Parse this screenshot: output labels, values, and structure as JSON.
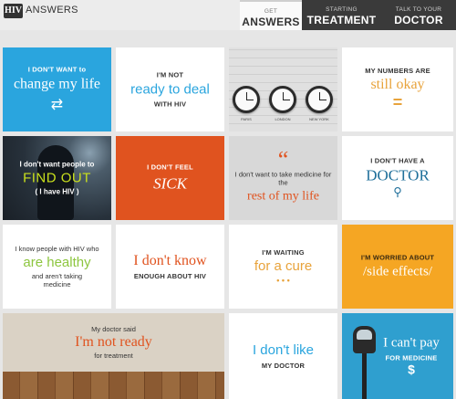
{
  "header": {
    "logo_box": "HIV",
    "logo_text": "ANSWERS",
    "nav": [
      {
        "small": "GET",
        "big": "ANSWERS"
      },
      {
        "small": "STARTING",
        "big": "TREATMENT"
      },
      {
        "small": "TALK TO YOUR",
        "big": "DOCTOR"
      }
    ]
  },
  "tiles": {
    "t1": {
      "top": "I DON'T WANT to",
      "main": "change my life",
      "icon": "⇄"
    },
    "t2": {
      "top": "I'M NOT",
      "main": "ready to deal",
      "bottom": "WITH HIV"
    },
    "t3": {
      "clocks": [
        "PARIS",
        "LONDON",
        "NEW YORK"
      ]
    },
    "t4": {
      "top": "MY NUMBERS ARE",
      "main": "still okay",
      "icon": "="
    },
    "t5": {
      "top": "I don't want people to",
      "main": "FIND OUT",
      "bottom": "( I have HIV )"
    },
    "t6": {
      "top": "I DON'T FEEL",
      "main": "SICK"
    },
    "t7": {
      "quote": "“",
      "top": "I don't want to take medicine for the",
      "main": "rest of my life"
    },
    "t8": {
      "top": "I DON'T HAVE A",
      "main": "DOCTOR",
      "icon": "⚲"
    },
    "t9": {
      "top": "I know people with HIV who",
      "main": "are healthy",
      "bottom": "and aren't taking medicine"
    },
    "t10": {
      "main": "I don't know",
      "bottom": "ENOUGH ABOUT HIV"
    },
    "t11": {
      "top": "I'M WAITING",
      "main": "for a cure",
      "icon": "• • •"
    },
    "t12": {
      "top": "I'M WORRIED ABOUT",
      "main": "/side effects/"
    },
    "t13": {
      "top": "My doctor said",
      "main": "I'm not ready",
      "bottom": "for treatment"
    },
    "t14": {
      "main": "I don't like",
      "bottom": "MY DOCTOR"
    },
    "t15": {
      "main": "I can't pay",
      "bottom": "FOR MEDICINE",
      "icon": "$"
    }
  },
  "colors": {
    "blue": "#2aa5de",
    "orange_red": "#e0531f",
    "amber": "#f5a623",
    "green": "#8dc63f",
    "gold": "#e8a33b",
    "teal": "#2f9fcf"
  }
}
